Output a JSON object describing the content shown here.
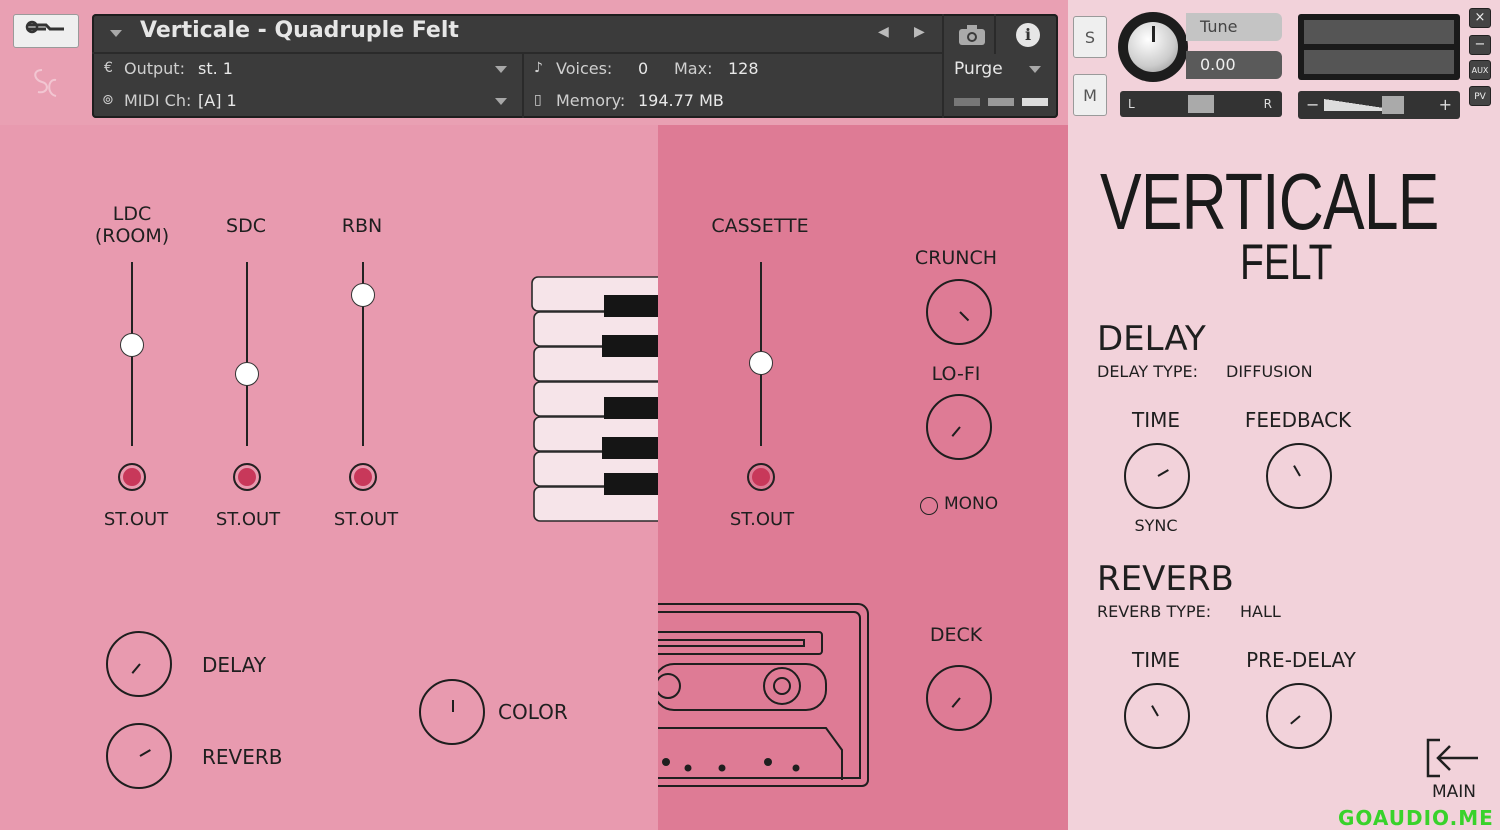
{
  "header": {
    "instrument_name": "Verticale - Quadruple Felt",
    "output_label": "Output:",
    "output_value": "st. 1",
    "midi_label": "MIDI Ch:",
    "midi_value": "[A]  1",
    "voices_label": "Voices:",
    "voices_value": "0",
    "max_label": "Max:",
    "max_value": "128",
    "memory_label": "Memory:",
    "memory_value": "194.77 MB",
    "purge_label": "Purge"
  },
  "side": {
    "solo_label": "S",
    "mute_label": "M",
    "tune_label": "Tune",
    "tune_value": "0.00",
    "pan_left": "L",
    "pan_right": "R",
    "vol_minus": "−",
    "vol_plus": "+",
    "close_label": "×",
    "minimize_label": "−",
    "aux_label": "AUX",
    "pv_label": "PV"
  },
  "mics": [
    {
      "label": "LDC\n(ROOM)",
      "out_label": "ST.OUT",
      "level": 0.55
    },
    {
      "label": "SDC",
      "out_label": "ST.OUT",
      "level": 0.39
    },
    {
      "label": "RBN",
      "out_label": "ST.OUT",
      "level": 0.82
    }
  ],
  "cassette": {
    "label": "CASSETTE",
    "out_label": "ST.OUT",
    "level": 0.45
  },
  "fx": {
    "crunch_label": "CRUNCH",
    "lofi_label": "LO-FI",
    "mono_label": "MONO",
    "deck_label": "DECK"
  },
  "sends": {
    "delay_label": "DELAY",
    "reverb_label": "REVERB",
    "color_label": "COLOR"
  },
  "brand": {
    "title": "VERTICALE",
    "subtitle": "FELT"
  },
  "delay": {
    "heading": "DELAY",
    "type_label": "DELAY TYPE:",
    "type_value": "DIFFUSION",
    "time_label": "TIME",
    "feedback_label": "FEEDBACK",
    "sync_label": "SYNC"
  },
  "reverb": {
    "heading": "REVERB",
    "type_label": "REVERB TYPE:",
    "type_value": "HALL",
    "time_label": "TIME",
    "predelay_label": "PRE-DELAY"
  },
  "nav": {
    "main_label": "MAIN"
  },
  "watermark": "GOAUDIO.ME",
  "colors": {
    "led": "#c8385a",
    "left_bg": "#e89aaf",
    "mid_bg": "#de7b95",
    "right_bg": "#f2d2da"
  }
}
